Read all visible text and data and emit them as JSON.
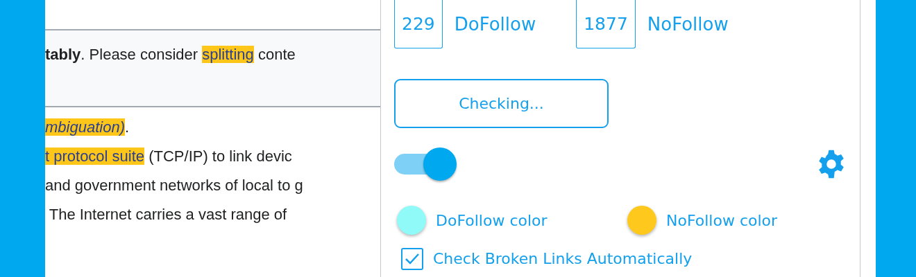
{
  "article": {
    "notice": [
      {
        "text": "**tably**. Please consider ",
        "highlight": false
      },
      {
        "text": "splitting",
        "highlight": true
      },
      {
        "text": " conte",
        "highlight": false
      }
    ],
    "lines": [
      [
        {
          "text": "*mbiguation)*",
          "highlight": true
        },
        {
          "text": ".",
          "highlight": false
        }
      ],
      [
        {
          "text": "t protocol suite",
          "highlight": true
        },
        {
          "text": " (TCP/IP) to link devic",
          "highlight": false
        }
      ],
      [
        {
          "text": "and government networks of local to g",
          "highlight": false
        }
      ],
      [
        {
          "text": " The Internet carries a vast range of",
          "highlight": false
        }
      ]
    ]
  },
  "popup": {
    "counts": [
      {
        "value": "229",
        "label": "DoFollow"
      },
      {
        "value": "1877",
        "label": "NoFollow"
      }
    ],
    "check_button": "Checking...",
    "toggle": {
      "on": true
    },
    "colors": [
      {
        "label": "DoFollow color",
        "color": "#8ffaf8"
      },
      {
        "label": "NoFollow color",
        "color": "#fec91c"
      }
    ],
    "auto_check": {
      "label": "Check Broken Links Automatically",
      "checked": true
    }
  }
}
